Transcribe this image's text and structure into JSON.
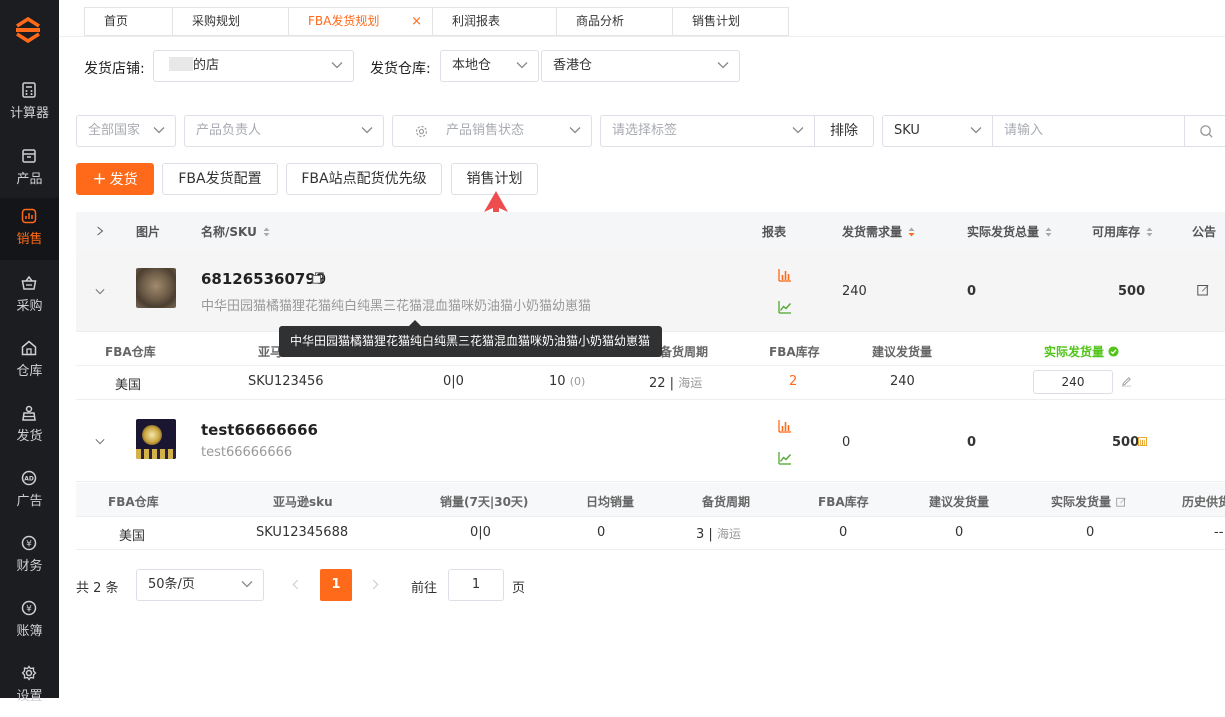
{
  "sidebar": {
    "items": [
      {
        "label": "计算器",
        "icon": "calculator-icon"
      },
      {
        "label": "产品",
        "icon": "product-icon"
      },
      {
        "label": "销售",
        "icon": "sales-chart-icon",
        "active": true
      },
      {
        "label": "采购",
        "icon": "basket-icon"
      },
      {
        "label": "仓库",
        "icon": "warehouse-icon"
      },
      {
        "label": "发货",
        "icon": "shipping-icon"
      },
      {
        "label": "广告",
        "icon": "ad-icon"
      },
      {
        "label": "财务",
        "icon": "yen-icon"
      },
      {
        "label": "账簿",
        "icon": "ledger-icon"
      },
      {
        "label": "设置",
        "icon": "gear-icon"
      }
    ]
  },
  "tabs": [
    {
      "label": "首页"
    },
    {
      "label": "采购规划"
    },
    {
      "label": "FBA发货规划",
      "active": true,
      "close": "×"
    },
    {
      "label": "利润报表"
    },
    {
      "label": "商品分析"
    },
    {
      "label": "销售计划"
    }
  ],
  "filters1": {
    "store_label": "发货店铺:",
    "store_value": "的店",
    "warehouse_label": "发货仓库:",
    "warehouse_type": "本地仓",
    "warehouse_value": "香港仓"
  },
  "filters2": {
    "country_placeholder": "全部国家",
    "owner_placeholder": "产品负责人",
    "status_placeholder": "产品销售状态",
    "tag_placeholder": "请选择标签",
    "exclude_label": "排除",
    "sku_select": "SKU",
    "search_placeholder": "请输入"
  },
  "actions": {
    "ship_label": "发货",
    "config_label": "FBA发货配置",
    "priority_label": "FBA站点配货优先级",
    "plan_label": "销售计划"
  },
  "table": {
    "headers": {
      "image": "图片",
      "name_sku": "名称/SKU",
      "report": "报表",
      "demand": "发货需求量",
      "actual_total": "实际发货总量",
      "available": "可用库存",
      "notice": "公告"
    },
    "rows": [
      {
        "sku_code": "681265360799",
        "name": "中华田园猫橘猫狸花猫纯白纯黑三花猫混血猫咪奶油猫小奶猫幼崽猫",
        "demand": "240",
        "actual_total": "0",
        "available": "500",
        "sub": {
          "headers": {
            "fba_warehouse": "FBA仓库",
            "amazon_sku": "亚马",
            "stock_cycle": "备货周期",
            "fba_stock": "FBA库存",
            "suggested": "建议发货量",
            "actual": "实际发货量"
          },
          "row": {
            "country": "美国",
            "amazon_sku": "SKU123456",
            "sales": "0|0",
            "daily": "10",
            "daily_extra": "(0)",
            "cycle": "22",
            "cycle_mode": "海运",
            "fba_stock": "2",
            "suggested": "240",
            "actual_input": "240"
          }
        }
      },
      {
        "sku_code": "test66666666",
        "name": "test66666666",
        "demand": "0",
        "actual_total": "0",
        "available": "500",
        "sub": {
          "headers": {
            "fba_warehouse": "FBA仓库",
            "amazon_sku": "亚马逊sku",
            "sales": "销量(7天|30天)",
            "daily": "日均销量",
            "stock_cycle": "备货周期",
            "fba_stock": "FBA库存",
            "suggested": "建议发货量",
            "actual": "实际发货量",
            "history": "历史供货"
          },
          "row": {
            "country": "美国",
            "amazon_sku": "SKU12345688",
            "sales": "0|0",
            "daily": "0",
            "cycle": "3",
            "cycle_mode": "海运",
            "fba_stock": "0",
            "suggested": "0",
            "actual": "0",
            "history": "--"
          }
        }
      }
    ]
  },
  "tooltip": {
    "text": "中华田园猫橘猫狸花猫纯白纯黑三花猫混血猫咪奶油猫小奶猫幼崽猫"
  },
  "pagination": {
    "total": "共 2 条",
    "page_size": "50条/页",
    "current": "1",
    "goto_label": "前往",
    "goto_value": "1",
    "page_suffix": "页"
  },
  "colors": {
    "accent": "#ff6a1a",
    "sidebar_bg": "#1c1d21",
    "success": "#52c41a",
    "annotation_arrow": "#ee4d4d"
  }
}
